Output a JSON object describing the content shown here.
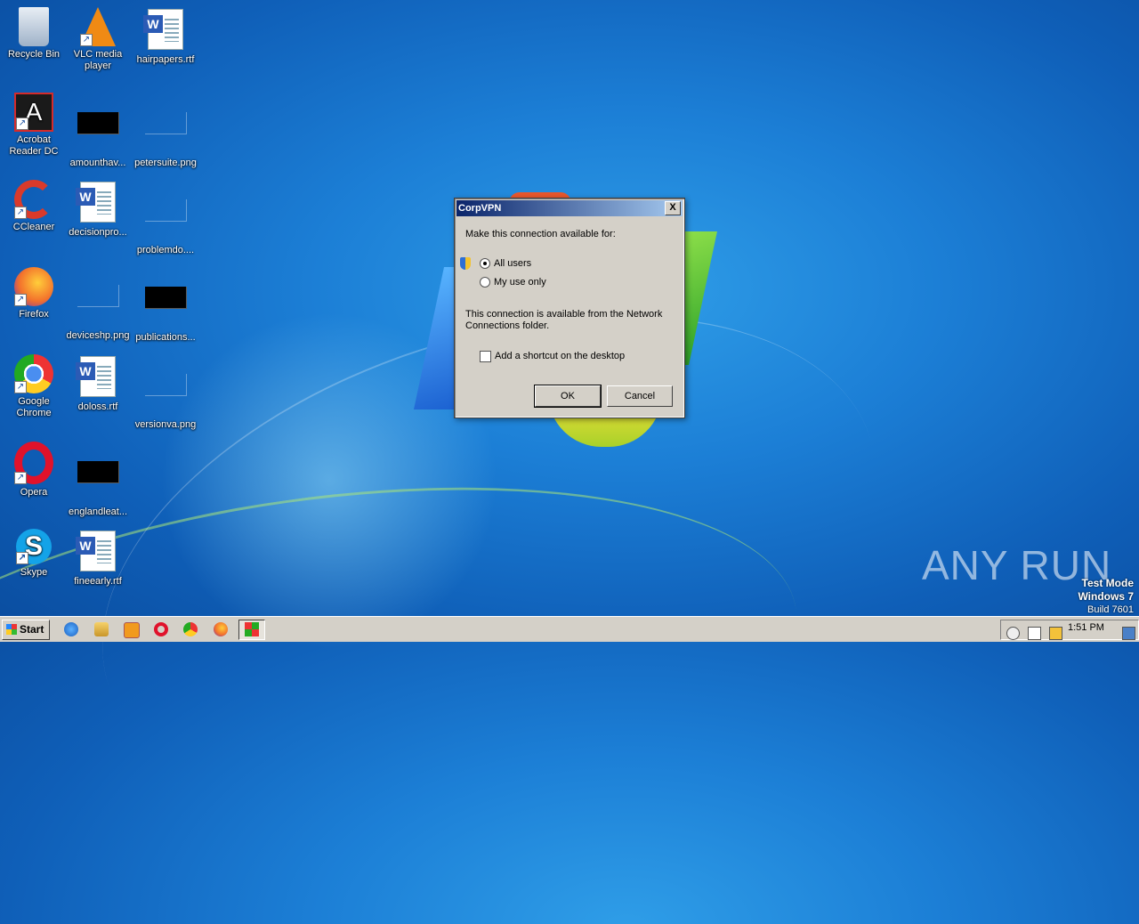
{
  "desktop": {
    "icons": [
      {
        "label": "Recycle Bin"
      },
      {
        "label": "VLC media player"
      },
      {
        "label": "hairpapers.rtf"
      },
      {
        "label": "Acrobat Reader DC"
      },
      {
        "label": "amounthav..."
      },
      {
        "label": "petersuite.png"
      },
      {
        "label": "CCleaner"
      },
      {
        "label": "decisionpro..."
      },
      {
        "label": "problemdo...."
      },
      {
        "label": "Firefox"
      },
      {
        "label": "deviceshp.png"
      },
      {
        "label": "publications..."
      },
      {
        "label": "Google Chrome"
      },
      {
        "label": "doloss.rtf"
      },
      {
        "label": "versionva.png"
      },
      {
        "label": "Opera"
      },
      {
        "label": "englandleat..."
      },
      {
        "label": "Skype"
      },
      {
        "label": "fineearly.rtf"
      }
    ],
    "watermark": "ANY RUN",
    "test_mode": {
      "line1": "Test Mode",
      "line2": "Windows 7",
      "line3": "Build 7601"
    }
  },
  "dialog": {
    "title": "CorpVPN",
    "close_glyph": "X",
    "prompt": "Make this connection available for:",
    "options": [
      {
        "label": "All users",
        "selected": true
      },
      {
        "label": "My use only",
        "selected": false
      }
    ],
    "info": "This connection is available from the Network Connections folder.",
    "shortcut_checkbox": {
      "label": "Add a shortcut on the desktop",
      "checked": false
    },
    "ok_label": "OK",
    "cancel_label": "Cancel"
  },
  "taskbar": {
    "start_label": "Start",
    "clock": "1:51 PM",
    "pinned": [
      "ie-icon",
      "explorer-icon",
      "media-player-icon",
      "opera-icon",
      "chrome-icon",
      "firefox-icon"
    ]
  }
}
